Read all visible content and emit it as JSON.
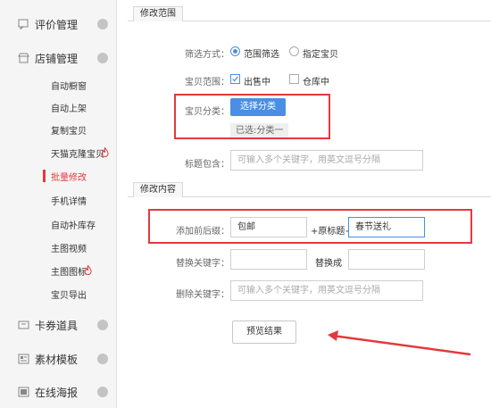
{
  "sidebar": {
    "groups": [
      {
        "label": "评价管理"
      },
      {
        "label": "店铺管理"
      },
      {
        "label": "卡券道具"
      },
      {
        "label": "素材模板"
      },
      {
        "label": "在线海报"
      }
    ],
    "sub_items": [
      {
        "label": "自动橱窗"
      },
      {
        "label": "自动上架"
      },
      {
        "label": "复制宝贝"
      },
      {
        "label": "天猫克隆宝贝"
      },
      {
        "label": "批量修改"
      },
      {
        "label": "手机详情"
      },
      {
        "label": "自动补库存"
      },
      {
        "label": "主图视频"
      },
      {
        "label": "主图图标"
      },
      {
        "label": "宝贝导出"
      }
    ]
  },
  "section_scope": {
    "title": "修改范围",
    "filter_label": "筛选方式：",
    "filter_options": [
      "范围筛选",
      "指定宝贝"
    ],
    "range_label": "宝贝范围：",
    "range_options": [
      "出售中",
      "仓库中"
    ],
    "category_label": "宝贝分类：",
    "category_button": "选择分类",
    "category_selected": "已选:分类一",
    "title_contains_label": "标题包含：",
    "title_contains_placeholder": "可输入多个关键字，用英文逗号分隔"
  },
  "section_content": {
    "title": "修改内容",
    "prefix_suffix_label": "添加前后缀：",
    "prefix_value": "包邮",
    "joiner_1": "+原标题+",
    "suffix_value": "春节送礼",
    "replace_label": "替换关键字：",
    "replace_with_label": "替换成",
    "delete_label": "删除关键字：",
    "delete_placeholder": "可输入多个关键字，用英文逗号分隔",
    "preview_button": "预览结果"
  },
  "colors": {
    "accent": "#4a8ee6",
    "highlight": "#e4393c"
  }
}
